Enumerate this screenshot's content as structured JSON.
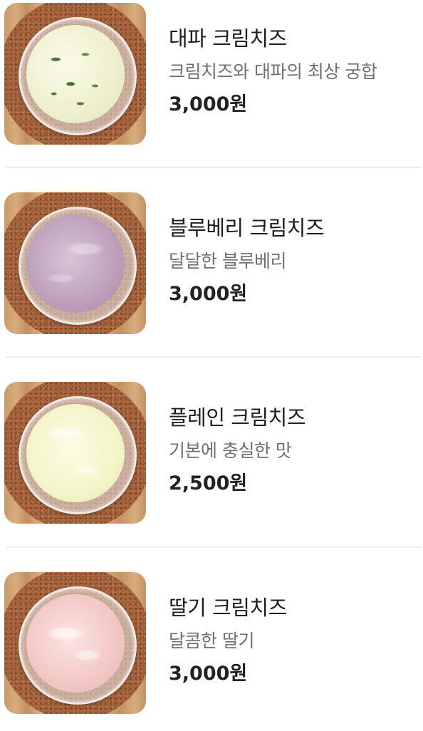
{
  "menu": {
    "items": [
      {
        "name": "대파 크림치즈",
        "description": "크림치즈와 대파의 최상 궁합",
        "price": "3,000원",
        "image_alt": "대파 크림치즈",
        "image_icon": "scallion-cream-cheese-photo"
      },
      {
        "name": "블루베리 크림치즈",
        "description": "달달한 블루베리",
        "price": "3,000원",
        "image_alt": "블루베리 크림치즈",
        "image_icon": "blueberry-cream-cheese-photo"
      },
      {
        "name": "플레인 크림치즈",
        "description": "기본에 충실한 맛",
        "price": "2,500원",
        "image_alt": "플레인 크림치즈",
        "image_icon": "plain-cream-cheese-photo"
      },
      {
        "name": "딸기 크림치즈",
        "description": "달콤한 딸기",
        "price": "3,000원",
        "image_alt": "딸기 크림치즈",
        "image_icon": "strawberry-cream-cheese-photo"
      }
    ]
  },
  "colors": {
    "title": "#1e1e1e",
    "description": "#707070",
    "price": "#222222",
    "divider": "#efefef"
  }
}
